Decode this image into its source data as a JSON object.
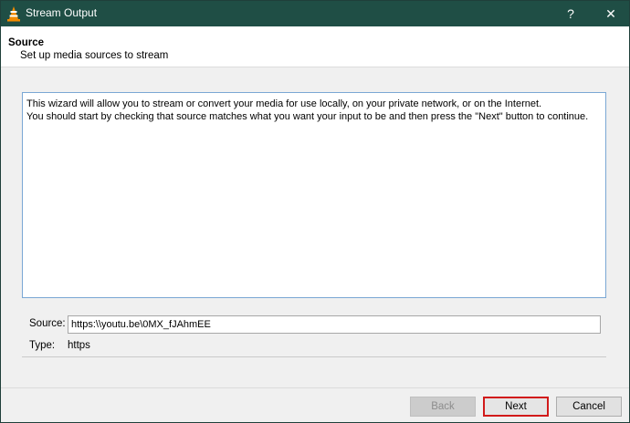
{
  "window": {
    "title": "Stream Output",
    "help_label": "?",
    "close_label": "✕",
    "icon": "vlc-cone-icon"
  },
  "header": {
    "title": "Source",
    "subtitle": "Set up media sources to stream"
  },
  "wizard": {
    "line1": "This wizard will allow you to stream or convert your media for use locally, on your private network, or on the Internet.",
    "line2": "You should start by checking that source matches what you want your input to be and then press the \"Next\" button to continue."
  },
  "source": {
    "label": "Source:",
    "value": "https:\\\\youtu.be\\0MX_fJAhmEE",
    "type_label": "Type:",
    "type_value": "https"
  },
  "buttons": {
    "back": "Back",
    "next": "Next",
    "cancel": "Cancel"
  },
  "colors": {
    "titlebar": "#1f4e45",
    "highlight": "#d11a1a",
    "text_border": "#7aa7d4"
  }
}
